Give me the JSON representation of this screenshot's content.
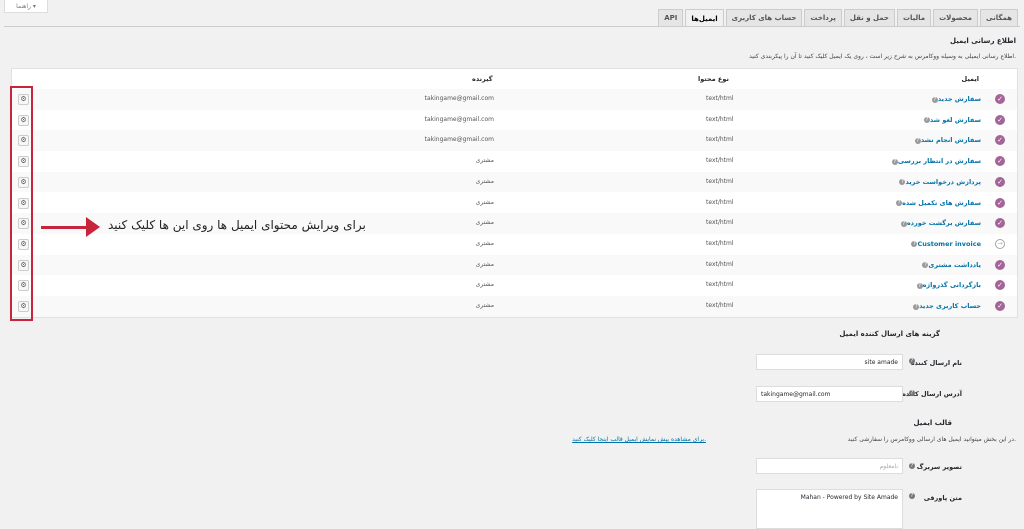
{
  "help": {
    "label": "راهنما",
    "caret": "▾"
  },
  "tabs": [
    "همگانی",
    "محصولات",
    "مالیات",
    "حمل و نقل",
    "پرداخت",
    "حساب های کاربری",
    "ایمیل‌ها",
    "API"
  ],
  "notifications": {
    "title": "اطلاع رسانی ایمیل",
    "description": "اطلاع رسانی ایمیلی به وسیله ووکامرس به شرح زیر است ، روی یک ایمیل کلیک کنید تا آن را پیکربندی کنید."
  },
  "table": {
    "headers": {
      "email": "ایمیل",
      "content_type": "نوع محتوا",
      "recipient": "گیرنده"
    },
    "rows": [
      {
        "name": "سفارش جدید",
        "type": "text/html",
        "recipient": "takingame@gmail.com",
        "enabled": true
      },
      {
        "name": "سفارش لغو شد",
        "type": "text/html",
        "recipient": "takingame@gmail.com",
        "enabled": true
      },
      {
        "name": "سفارش انجام نشد",
        "type": "text/html",
        "recipient": "takingame@gmail.com",
        "enabled": true
      },
      {
        "name": "سفارش در انتظار بررسی",
        "type": "text/html",
        "recipient": "مشتری",
        "enabled": true
      },
      {
        "name": "پردازش درخواست خرید",
        "type": "text/html",
        "recipient": "مشتری",
        "enabled": true
      },
      {
        "name": "سفارش های تکمیل شده",
        "type": "text/html",
        "recipient": "مشتری",
        "enabled": true
      },
      {
        "name": "سفارش برگشت خورده",
        "type": "text/html",
        "recipient": "مشتری",
        "enabled": true
      },
      {
        "name": "Customer invoice",
        "type": "text/html",
        "recipient": "مشتری",
        "enabled": false
      },
      {
        "name": "یادداشت مشتری",
        "type": "text/html",
        "recipient": "مشتری",
        "enabled": true
      },
      {
        "name": "بازگردانی گذرواژه",
        "type": "text/html",
        "recipient": "مشتری",
        "enabled": true
      },
      {
        "name": "حساب کاربری جدید",
        "type": "text/html",
        "recipient": "مشتری",
        "enabled": true
      }
    ]
  },
  "annotation": {
    "text": "برای ویرایش محتوای ایمیل ها روی این ها کلیک کنید",
    "color": "#c8243c"
  },
  "sender": {
    "title": "گزینه های ارسال کننده ایمیل",
    "from_name_label": "نام ارسال کننده",
    "from_name_value": "site amade",
    "from_address_label": "آدرس ارسال کننده",
    "from_address_value": "takingame@gmail.com"
  },
  "template": {
    "title": "قالب ایمیل",
    "desc_prefix": "در این بخش میتوانید ایمیل های ارسالی ووکامرس را سفارشی کنید.",
    "desc_link": "برای مشاهده پیش نمایش ایمیل قالب اینجا کلیک کنید.",
    "header_image_label": "تصویر سربرگ",
    "header_image_placeholder": "نامعلوم",
    "footer_text_label": "متن پاورقی",
    "footer_text_value": "Mahan - Powered by Site Amade"
  },
  "colors": {
    "accent": "#a46497",
    "link": "#0073aa",
    "highlight": "#c8243c"
  }
}
